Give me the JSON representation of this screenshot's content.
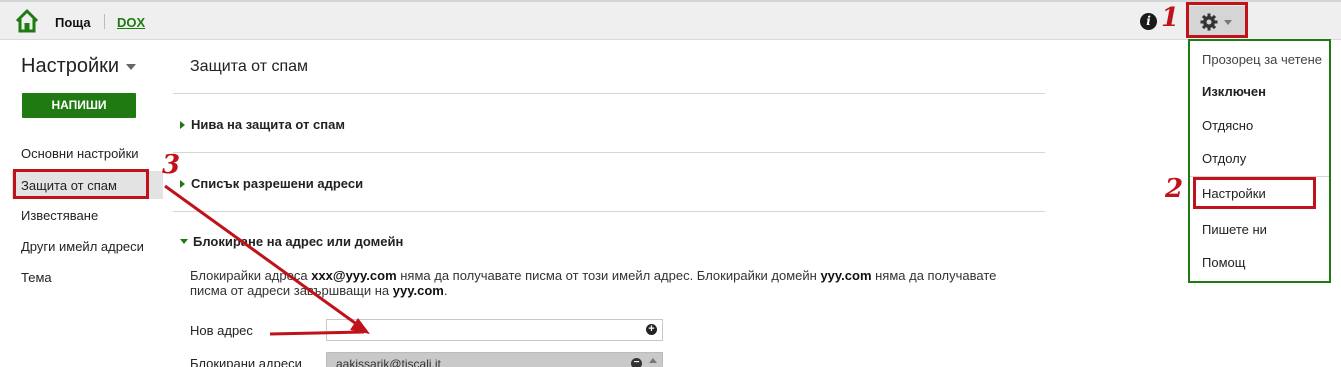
{
  "topbar": {
    "brand": "Поща",
    "dox_link": "DOX",
    "info_icon": "info-icon",
    "gear_icon": "gear-icon"
  },
  "sidebar": {
    "title": "Настройки",
    "compose_label": "НАПИШИ",
    "items": [
      {
        "label": "Основни настройки"
      },
      {
        "label": "Защита от спам",
        "active": true
      },
      {
        "label": "Известяване"
      },
      {
        "label": "Други имейл адреси"
      },
      {
        "label": "Тема"
      }
    ]
  },
  "main": {
    "title": "Защита от спам",
    "sections": [
      {
        "label": "Нива на защита от спам",
        "expanded": false
      },
      {
        "label": "Списък разрешени адреси",
        "expanded": false
      },
      {
        "label": "Блокиране на адрес или домейн",
        "expanded": true
      }
    ],
    "description": {
      "part1": "Блокирайки адреса ",
      "email_example": "xxx@yyy.com",
      "part2": " няма да получавате писма от този имейл адрес. Блокирайки домейн ",
      "domain_example": "yyy.com",
      "part3": " няма да получавате писма от адреси завършващи на ",
      "domain_example_2": "yyy.com",
      "part4": "."
    },
    "new_address_label": "Нов адрес",
    "new_address_value": "",
    "blocked_label": "Блокирани адреси",
    "blocked_addresses": [
      "aakissarik@tiscali.it"
    ]
  },
  "menu": {
    "items": [
      {
        "label": "Прозорец за четене"
      },
      {
        "label": "Изключен",
        "selected": true
      },
      {
        "label": "Отдясно"
      },
      {
        "label": "Отдолу"
      },
      {
        "label": "Настройки"
      },
      {
        "label": "Пишете ни"
      },
      {
        "label": "Помощ"
      }
    ]
  },
  "annotations": {
    "step1": "1",
    "step2": "2",
    "step3": "3",
    "color": "#c0121a"
  },
  "colors": {
    "accent_green": "#1f7a12",
    "topbar_bg": "#efefef"
  }
}
